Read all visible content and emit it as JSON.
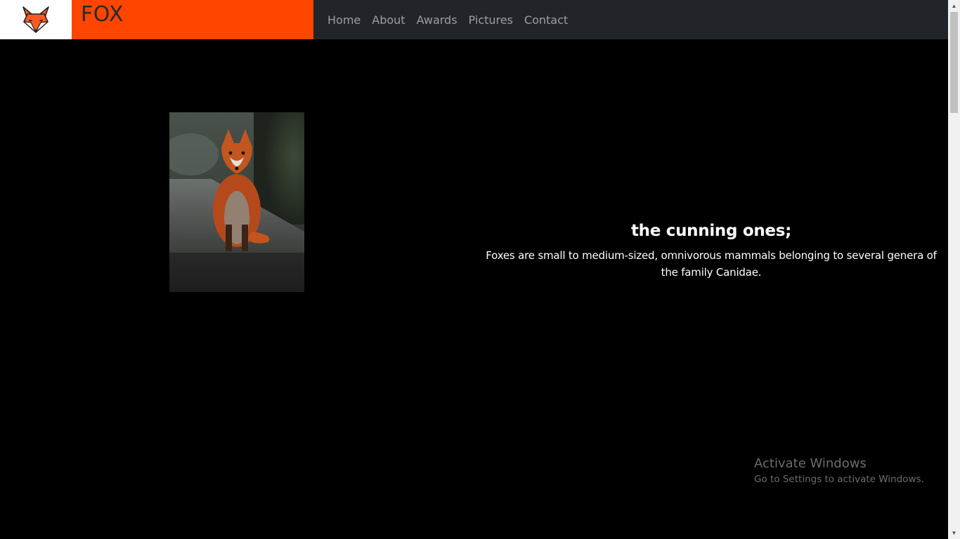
{
  "header": {
    "logo_icon": "fox-head-icon",
    "brand": "FOX",
    "brand_color": "#ff4500",
    "nav": [
      {
        "label": "Home"
      },
      {
        "label": "About"
      },
      {
        "label": "Awards"
      },
      {
        "label": "Pictures"
      },
      {
        "label": "Contact"
      }
    ]
  },
  "main": {
    "image_subject": "red fox sitting on a path",
    "headline": "the cunning ones;",
    "description": "Foxes are small to medium-sized, omnivorous mammals belonging to several genera of the family Canidae."
  },
  "watermark": {
    "title": "Activate Windows",
    "subtitle": "Go to Settings to activate Windows."
  },
  "colors": {
    "background": "#000000",
    "navbar": "#212529",
    "accent": "#ff4500"
  }
}
